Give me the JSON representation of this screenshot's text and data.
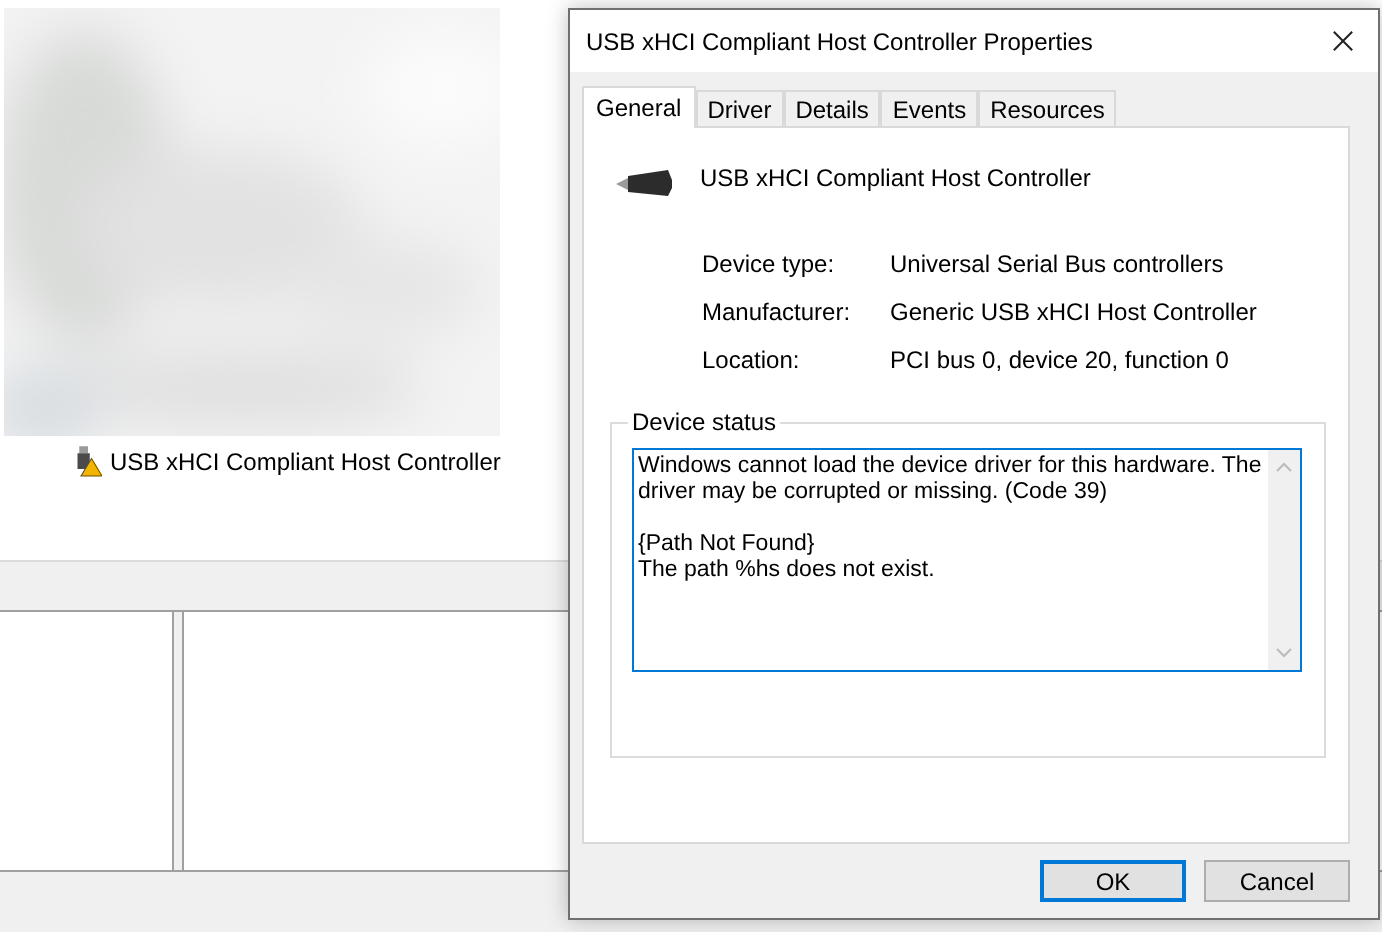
{
  "background_window": {
    "tree_item": {
      "label": "USB xHCI Compliant Host Controller",
      "warning": true
    }
  },
  "dialog": {
    "title": "USB xHCI Compliant Host Controller Properties",
    "tabs": [
      {
        "label": "General",
        "selected": true
      },
      {
        "label": "Driver",
        "selected": false
      },
      {
        "label": "Details",
        "selected": false
      },
      {
        "label": "Events",
        "selected": false
      },
      {
        "label": "Resources",
        "selected": false
      }
    ],
    "device_name": "USB xHCI Compliant Host Controller",
    "properties": [
      {
        "label": "Device type:",
        "value": "Universal Serial Bus controllers"
      },
      {
        "label": "Manufacturer:",
        "value": "Generic USB xHCI Host Controller"
      },
      {
        "label": "Location:",
        "value": "PCI bus 0, device 20, function 0"
      }
    ],
    "status": {
      "label": "Device status",
      "text": "Windows cannot load the device driver for this hardware. The driver may be corrupted or missing. (Code 39)\n\n{Path Not Found}\nThe path %hs does not exist."
    },
    "buttons": [
      {
        "label": "OK",
        "default": true
      },
      {
        "label": "Cancel",
        "default": false
      }
    ]
  }
}
